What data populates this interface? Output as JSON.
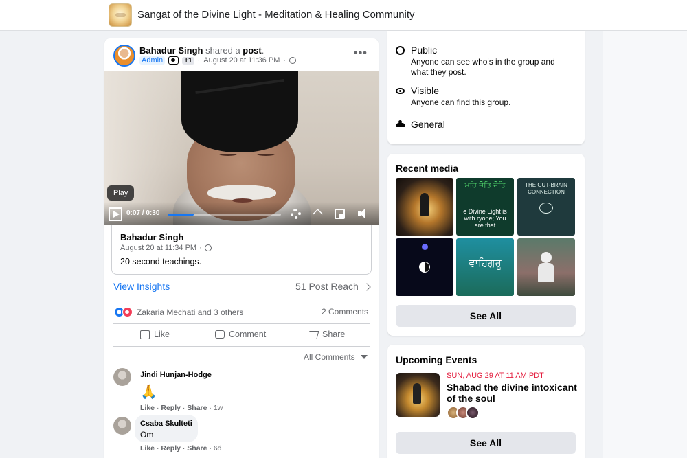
{
  "header": {
    "group_name": "Sangat of the Divine Light - Meditation & Healing Community"
  },
  "post": {
    "author": "Bahadur Singh",
    "shared_text": "shared a",
    "shared_object": "post",
    "shared_period": ".",
    "role_badge": "Admin",
    "extra_badges": "+1",
    "timestamp": "August 20 at 11:36 PM",
    "timestamp_sep": "·",
    "more_label": "•••",
    "video": {
      "tooltip": "Play",
      "current_time": "0:07",
      "duration": "0:30",
      "time_sep": "/",
      "progress_fraction": 0.23
    },
    "shared": {
      "author": "Bahadur Singh",
      "timestamp": "August 20 at 11:34 PM",
      "timestamp_sep": "·",
      "text": "20 second teachings."
    },
    "insights_label": "View Insights",
    "reach_label": "51 Post Reach",
    "reactions_text": "Zakaria Mechati and 3 others",
    "comments_count": "2 Comments",
    "actions": {
      "like": "Like",
      "comment": "Comment",
      "share": "Share"
    },
    "comments_filter": "All Comments",
    "comments": [
      {
        "author": "Jindi Hunjan-Hodge",
        "emoji": "🙏",
        "like": "Like",
        "reply": "Reply",
        "share": "Share",
        "sep": "·",
        "age": "1w"
      },
      {
        "author": "Csaba Skulteti",
        "text": "Om",
        "like": "Like",
        "reply": "Reply",
        "share": "Share",
        "sep": "·",
        "age": "6d"
      }
    ]
  },
  "about": {
    "public": {
      "title": "Public",
      "desc": "Anyone can see who's in the group and what they post.",
      "icon": "globe-icon"
    },
    "visible": {
      "title": "Visible",
      "desc": "Anyone can find this group.",
      "icon": "eye-icon"
    },
    "general": {
      "title": "General",
      "icon": "people-icon"
    }
  },
  "recent_media": {
    "heading": "Recent media",
    "tiles": [
      {
        "text": ""
      },
      {
        "text_top": "ਮਹਿ ਜੋਤਿ ਜੋਤਿ",
        "text_bottom": "e Divine Light is with ryone; You are that"
      },
      {
        "text_top": "THE GUT-BRAIN CONNECTION"
      },
      {
        "text": ""
      },
      {
        "text": "ਵਾਹਿਗੁਰੂ"
      },
      {
        "text": ""
      }
    ],
    "see_all": "See All"
  },
  "events": {
    "heading": "Upcoming Events",
    "date": "SUN, AUG 29 AT 11 AM PDT",
    "title": "Shabad the divine intoxicant of the soul",
    "see_all": "See All"
  },
  "colors": {
    "accent": "#1877f2",
    "event_date": "#e41e3f",
    "background": "#f0f2f5"
  }
}
